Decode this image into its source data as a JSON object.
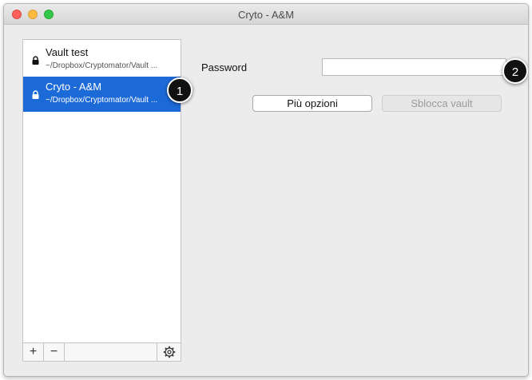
{
  "window": {
    "title": "Cryto - A&M"
  },
  "sidebar": {
    "vaults": [
      {
        "name": "Vault test",
        "path": "~/Dropbox/Cryptomator/Vault ...",
        "icon": "lock-icon",
        "selected": false
      },
      {
        "name": "Cryto - A&M",
        "path": "~/Dropbox/Cryptomator/Vault ...",
        "icon": "lock-icon",
        "selected": true
      }
    ],
    "add_label": "+",
    "remove_label": "−",
    "settings_icon": "gear-icon"
  },
  "main": {
    "password_label": "Password",
    "password_value": "",
    "options_button": "Più opzioni",
    "unlock_button": "Sblocca vault"
  },
  "callouts": [
    "1",
    "2"
  ],
  "colors": {
    "selection": "#1c6ad8",
    "window_bg": "#ececec",
    "traffic_close": "#fc605c",
    "traffic_min": "#fdbc40",
    "traffic_max": "#34c84a"
  }
}
